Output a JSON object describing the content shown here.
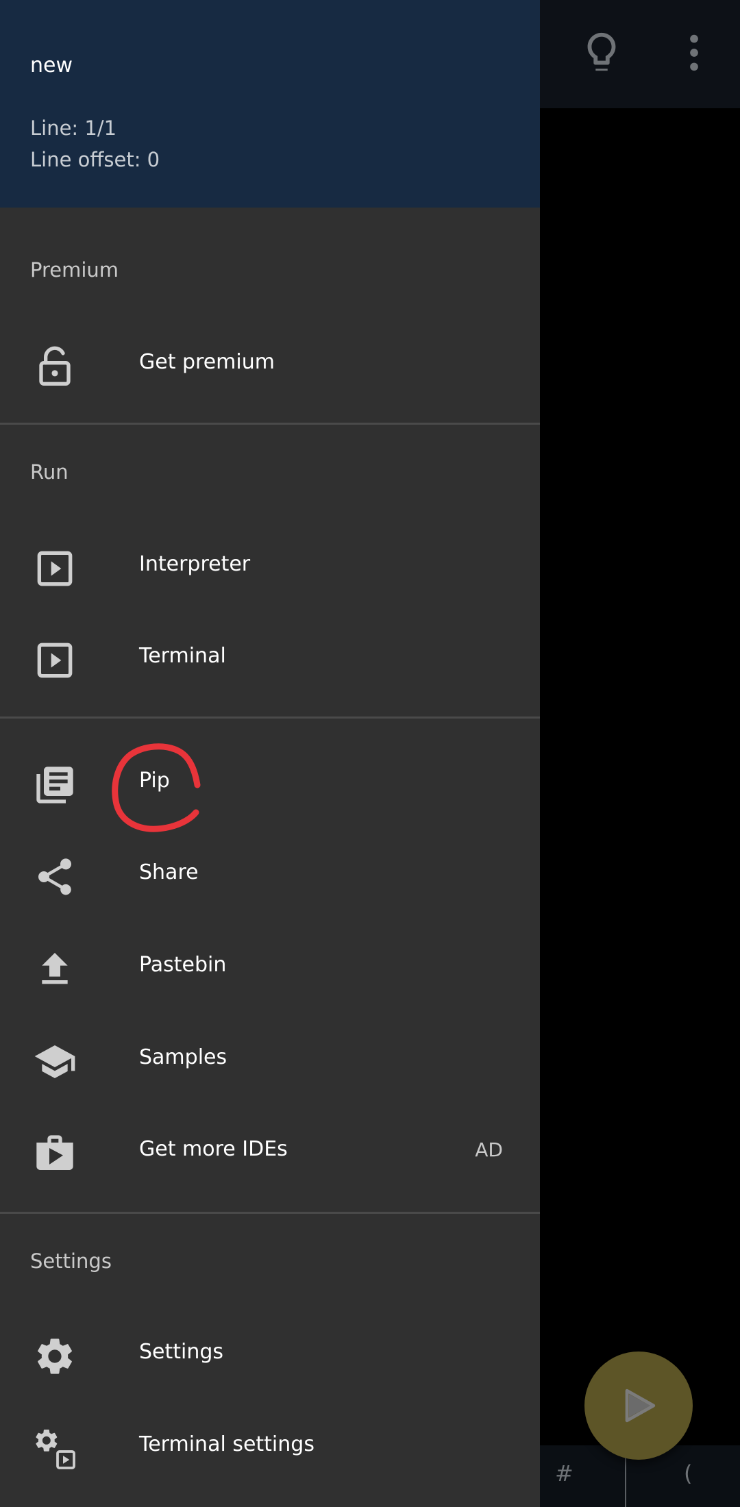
{
  "header": {
    "file_name": "new",
    "line": "Line: 1/1",
    "line_offset": "Line offset: 0"
  },
  "sections": {
    "premium": "Premium",
    "run": "Run",
    "settings": "Settings"
  },
  "items": {
    "get_premium": "Get premium",
    "interpreter": "Interpreter",
    "terminal": "Terminal",
    "pip": "Pip",
    "share": "Share",
    "pastebin": "Pastebin",
    "samples": "Samples",
    "get_more_ides": "Get more IDEs",
    "get_more_ides_badge": "AD",
    "settings": "Settings",
    "terminal_settings": "Terminal settings"
  },
  "symbol_bar": {
    "hash": "#",
    "paren": "("
  },
  "icons": {
    "get_premium": "lock-open-icon",
    "interpreter": "play-box-icon",
    "terminal": "play-box-icon",
    "pip": "library-books-icon",
    "share": "share-icon",
    "pastebin": "upload-icon",
    "samples": "school-icon",
    "get_more_ides": "shop-icon",
    "settings": "gear-icon",
    "terminal_settings": "gear-play-icon",
    "top_bulb": "lightbulb-icon",
    "top_more": "more-vert-icon",
    "fab": "play-icon"
  },
  "colors": {
    "drawer_bg": "#303030",
    "header_bg": "#172a42",
    "fab_bg": "#5d5527",
    "annotation": "#e8343a"
  }
}
